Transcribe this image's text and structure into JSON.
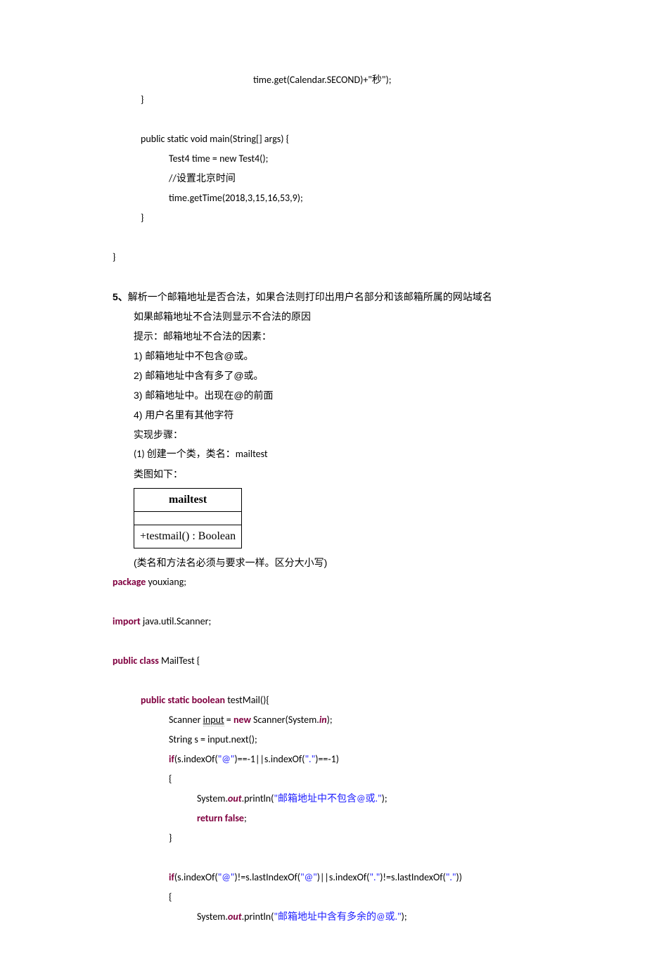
{
  "block1": {
    "l1": "time.get(Calendar.SECOND)+\"秒\");",
    "l2": "}",
    "l3": "public static void main(String[] args) {",
    "l4": "Test4 time = new Test4();",
    "l5": "//设置北京时间",
    "l6": "time.getTime(2018,3,15,16,53,9);",
    "l7": "}",
    "l8": "}"
  },
  "q5": {
    "num": "5、",
    "title": "解析一个邮箱地址是否合法，如果合法则打印出用户名部分和该邮箱所属的网站域名",
    "sub1": "如果邮箱地址不合法则显示不合法的原因",
    "sub2": "提示：邮箱地址不合法的因素：",
    "i1": "1)   邮箱地址中不包含@或。",
    "i2": "2)   邮箱地址中含有多了@或。",
    "i3": "3)   邮箱地址中。出现在@的前面",
    "i4": "4)   用户名里有其他字符",
    "step": "实现步骤：",
    "step1": "(1) 创建一个类，类名：mailtest",
    "step2": "类图如下：",
    "note": "(类名和方法名必须与要求一样。区分大小写)"
  },
  "uml": {
    "head": "mailtest",
    "method": "+testmail() : Boolean"
  },
  "code2": {
    "pkg_kw": "package",
    "pkg_rest": " youxiang;",
    "imp_kw": "import",
    "imp_rest": " java.util.Scanner;",
    "cls_kw": "public class",
    "cls_rest": " MailTest {",
    "m_kw": "public static boolean",
    "m_rest": " testMail(){",
    "sc_a": "Scanner ",
    "sc_input": "input",
    "sc_b": " = ",
    "sc_new": "new",
    "sc_c": " Scanner(System.",
    "sc_in": "in",
    "sc_d": ");",
    "s1": "String s = input.next();",
    "if1_kw": "if",
    "if1_a": "(s.indexOf(",
    "if1_at": "\"@\"",
    "if1_b": ")==-1||s.indexOf(",
    "if1_dot": "\".\"",
    "if1_c": ")==-1)",
    "brace_open": "{",
    "p1a": "System.",
    "p1_out": "out",
    "p1b": ".println(",
    "p1_str": "\"邮箱地址中不包含@或.\"",
    "p1c": ");",
    "ret_kw": "return false",
    "ret_semi": ";",
    "brace_close": "}",
    "if2_kw": "if",
    "if2_a": "(s.indexOf(",
    "if2_at": "\"@\"",
    "if2_b": ")!=s.lastIndexOf(",
    "if2_at2": "\"@\"",
    "if2_c": ")||s.indexOf(",
    "if2_dot": "\".\"",
    "if2_d": ")!=s.lastIndexOf(",
    "if2_dot2": "\".\"",
    "if2_e": "))",
    "p2a": "System.",
    "p2_out": "out",
    "p2b": ".println(",
    "p2_str": "\"邮箱地址中含有多余的@或.\"",
    "p2c": ");"
  }
}
